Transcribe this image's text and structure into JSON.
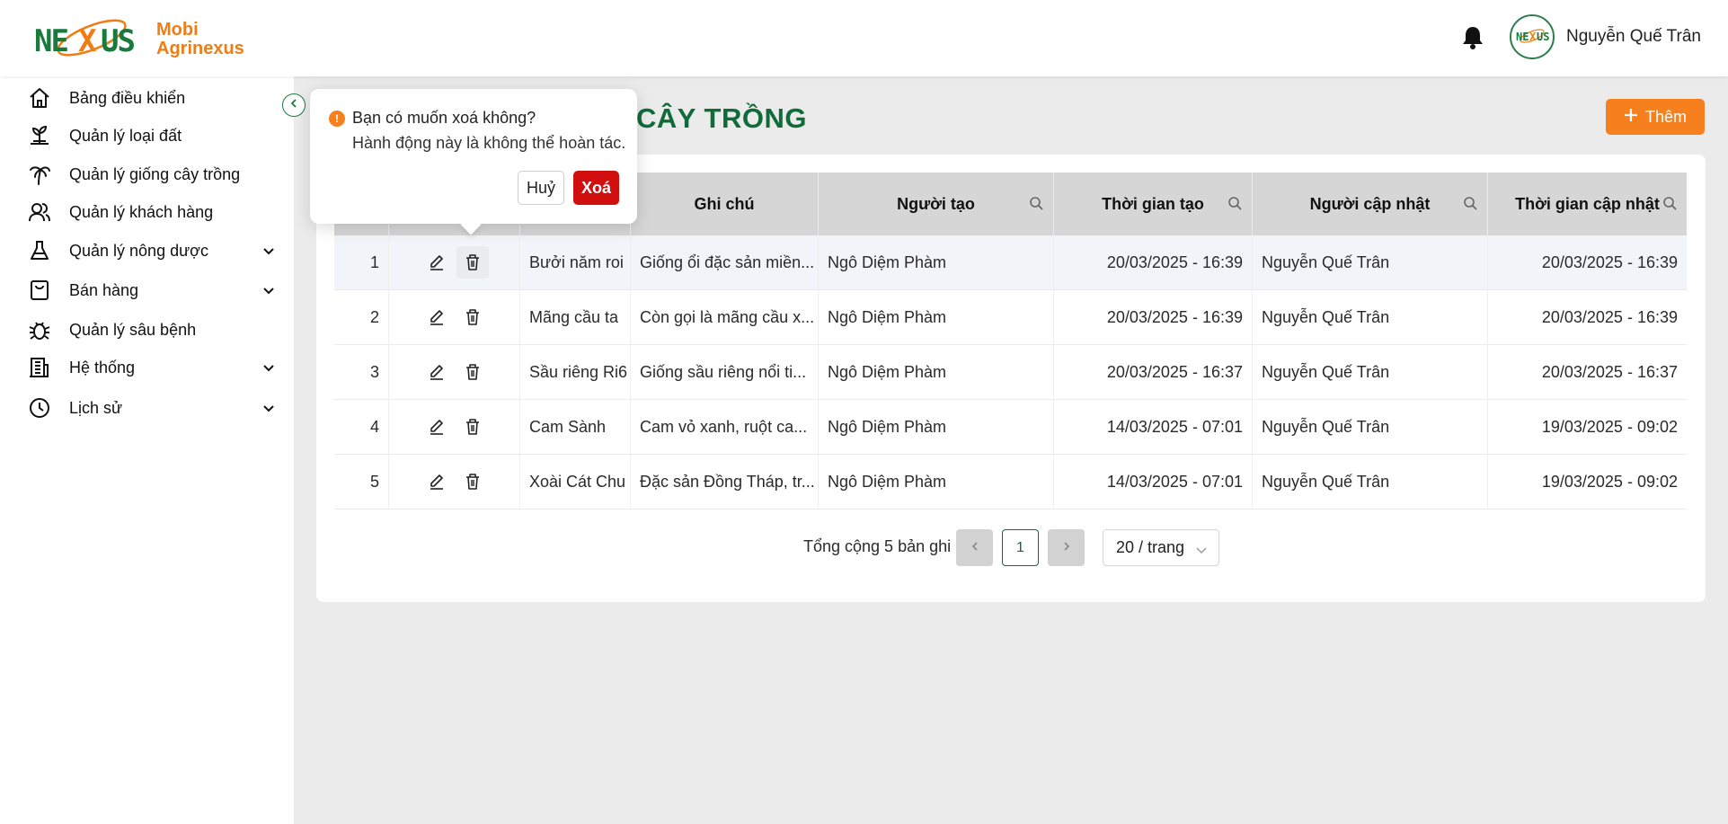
{
  "brand": {
    "line1": "Mobi",
    "line2": "Agrinexus",
    "logo_text": "NEXUS"
  },
  "header": {
    "username": "Nguyễn Quế Trân",
    "avatar_text": "NEXUS"
  },
  "sidebar": {
    "items": [
      {
        "label": "Bảng điều khiển",
        "icon": "home-icon",
        "has_children": false
      },
      {
        "label": "Quản lý loại đất",
        "icon": "sprout-icon",
        "has_children": false
      },
      {
        "label": "Quản lý giống cây trồng",
        "icon": "palm-tree-icon",
        "has_children": false
      },
      {
        "label": "Quản lý khách hàng",
        "icon": "users-icon",
        "has_children": false
      },
      {
        "label": "Quản lý nông dược",
        "icon": "flask-icon",
        "has_children": true
      },
      {
        "label": "Bán hàng",
        "icon": "shopping-bag-icon",
        "has_children": true
      },
      {
        "label": "Quản lý sâu bệnh",
        "icon": "bug-icon",
        "has_children": false
      },
      {
        "label": "Hệ thống",
        "icon": "building-icon",
        "has_children": true
      },
      {
        "label": "Lịch sử",
        "icon": "clock-icon",
        "has_children": true
      }
    ]
  },
  "page": {
    "title_visible": "CÂY TRỒNG",
    "add_label": "Thêm"
  },
  "table": {
    "headers": {
      "note": "Ghi chú",
      "creator": "Người tạo",
      "created_at": "Thời gian tạo",
      "updater": "Người cập nhật",
      "updated_at": "Thời gian cập nhật"
    },
    "rows": [
      {
        "index": "1",
        "name": "Bưởi năm roi",
        "note": "Giống ổi đặc sản miền...",
        "creator": "Ngô Diệm Phàm",
        "created_at": "20/03/2025 - 16:39",
        "updater": "Nguyễn Quế Trân",
        "updated_at": "20/03/2025 - 16:39"
      },
      {
        "index": "2",
        "name": "Mãng cầu ta",
        "note": "Còn gọi là mãng cầu x...",
        "creator": "Ngô Diệm Phàm",
        "created_at": "20/03/2025 - 16:39",
        "updater": "Nguyễn Quế Trân",
        "updated_at": "20/03/2025 - 16:39"
      },
      {
        "index": "3",
        "name": "Sầu riêng Ri6",
        "note": "Giống sầu riêng nổi ti...",
        "creator": "Ngô Diệm Phàm",
        "created_at": "20/03/2025 - 16:37",
        "updater": "Nguyễn Quế Trân",
        "updated_at": "20/03/2025 - 16:37"
      },
      {
        "index": "4",
        "name": "Cam Sành",
        "note": "Cam vỏ xanh, ruột ca...",
        "creator": "Ngô Diệm Phàm",
        "created_at": "14/03/2025 - 07:01",
        "updater": "Nguyễn Quế Trân",
        "updated_at": "19/03/2025 - 09:02"
      },
      {
        "index": "5",
        "name": "Xoài Cát Chu",
        "note": "Đặc sản Đồng Tháp, tr...",
        "creator": "Ngô Diệm Phàm",
        "created_at": "14/03/2025 - 07:01",
        "updater": "Nguyễn Quế Trân",
        "updated_at": "19/03/2025 - 09:02"
      }
    ]
  },
  "pagination": {
    "total_text": "Tổng cộng 5 bản ghi",
    "current_page": "1",
    "page_size": "20 / trang"
  },
  "popconfirm": {
    "title": "Bạn có muốn xoá không?",
    "description": "Hành động này là không thể hoàn tác.",
    "cancel_label": "Huỷ",
    "confirm_label": "Xoá"
  },
  "colors": {
    "primary_green": "#0f6b38",
    "accent_orange": "#f7801e",
    "danger_red": "#d10f0f"
  }
}
